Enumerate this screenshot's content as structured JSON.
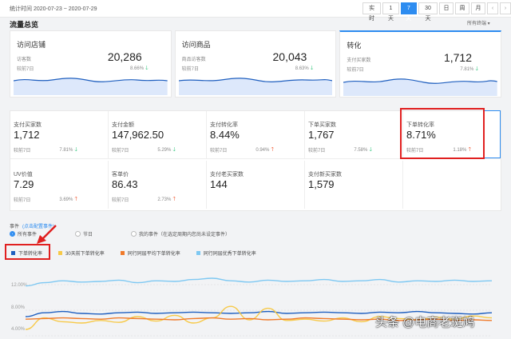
{
  "topbar": {
    "range": "统计时间 2020-07-23 ~ 2020-07-29",
    "periods": [
      "实时",
      "1天",
      "7天",
      "30天",
      "日",
      "周",
      "月"
    ],
    "active_period": "7天",
    "prev_icon": "chevron-left-icon",
    "next_icon": "chevron-right-icon"
  },
  "section": {
    "title": "流量总览",
    "filter": "所有终端 ▾"
  },
  "flow": [
    {
      "title": "访问店铺",
      "label": "访客数",
      "value": "20,286",
      "cmp": "较前7日",
      "pct": "8.66%",
      "dir": "down"
    },
    {
      "title": "访问商品",
      "label": "商品访客数",
      "value": "20,043",
      "cmp": "较前7日",
      "pct": "8.63%",
      "dir": "down"
    },
    {
      "title": "转化",
      "label": "支付买家数",
      "value": "1,712",
      "cmp": "较前7日",
      "pct": "7.81%",
      "dir": "down"
    }
  ],
  "metrics": [
    {
      "label": "支付买家数",
      "value": "1,712",
      "cmp": "较前7日",
      "pct": "7.81%",
      "dir": "down"
    },
    {
      "label": "支付金额",
      "value": "147,962.50",
      "cmp": "较前7日",
      "pct": "5.29%",
      "dir": "down"
    },
    {
      "label": "支付转化率",
      "value": "8.44%",
      "cmp": "较前7日",
      "pct": "0.94%",
      "dir": "up"
    },
    {
      "label": "下单买家数",
      "value": "1,767",
      "cmp": "较前7日",
      "pct": "7.58%",
      "dir": "down"
    },
    {
      "label": "下单转化率",
      "value": "8.71%",
      "cmp": "较前7日",
      "pct": "1.18%",
      "dir": "up"
    },
    {
      "label": "UV价值",
      "value": "7.29",
      "cmp": "较前7日",
      "pct": "3.69%",
      "dir": "up"
    },
    {
      "label": "客单价",
      "value": "86.43",
      "cmp": "较前7日",
      "pct": "2.73%",
      "dir": "up"
    },
    {
      "label": "支付老买家数",
      "value": "144",
      "cmp": "",
      "pct": "",
      "dir": ""
    },
    {
      "label": "支付新买家数",
      "value": "1,579",
      "cmp": "",
      "pct": "",
      "dir": ""
    }
  ],
  "events": {
    "label": "事件",
    "link": "(点击配置事件)",
    "options": [
      "所有事件",
      "节日",
      "我的事件（在选定周期内您尚未设定事件）"
    ],
    "selected": "所有事件"
  },
  "colors": {
    "accent": "#2d8cf0",
    "down": "#19be6b",
    "up": "#ed4014",
    "highlight": "#e02020"
  },
  "chart_data": {
    "type": "line",
    "series": [
      {
        "name": "下单转化率",
        "color": "#1f5fbf",
        "values": [
          7.0,
          7.6,
          7.8,
          7.5,
          7.4,
          7.6,
          7.7,
          7.5,
          7.6,
          7.7,
          7.6,
          7.5,
          7.6,
          7.8,
          7.5,
          7.6,
          7.7,
          7.6,
          7.5,
          7.7,
          7.6,
          7.8,
          7.6,
          7.5,
          7.4,
          7.6
        ]
      },
      {
        "name": "30天前下单转化率",
        "color": "#f7c948",
        "values": [
          5.0,
          6.8,
          6.2,
          6.0,
          6.4,
          6.1,
          7.0,
          6.3,
          7.2,
          6.0,
          6.8,
          8.6,
          6.5,
          8.3,
          6.4,
          6.6,
          6.3,
          6.8,
          6.2,
          7.0,
          6.7,
          6.5,
          6.9,
          6.6,
          7.1,
          6.8
        ]
      },
      {
        "name": "同行同层平均下单转化率",
        "color": "#f07a2a",
        "values": [
          6.6,
          6.7,
          6.8,
          6.7,
          6.6,
          6.8,
          6.7,
          6.6,
          6.5,
          6.7,
          6.8,
          6.6,
          6.7,
          6.5,
          6.6,
          6.8,
          6.7,
          6.6,
          6.5,
          6.6,
          6.4,
          6.5,
          6.6,
          6.4,
          6.5,
          6.4
        ]
      },
      {
        "name": "同行同层优秀下单转化率",
        "color": "#7ec8f2",
        "values": [
          11.8,
          12.3,
          12.6,
          12.4,
          12.5,
          12.7,
          12.3,
          12.6,
          12.5,
          12.8,
          13.0,
          12.6,
          12.4,
          12.7,
          12.5,
          12.6,
          12.8,
          12.5,
          12.6,
          12.8,
          12.4,
          12.6,
          12.5,
          12.7,
          12.5,
          12.6
        ]
      }
    ],
    "yticks": [
      "12.00%",
      "8.00%",
      "4.00%"
    ],
    "ylim": [
      4,
      14
    ]
  },
  "watermark": "头条 @电商老斑鸠"
}
